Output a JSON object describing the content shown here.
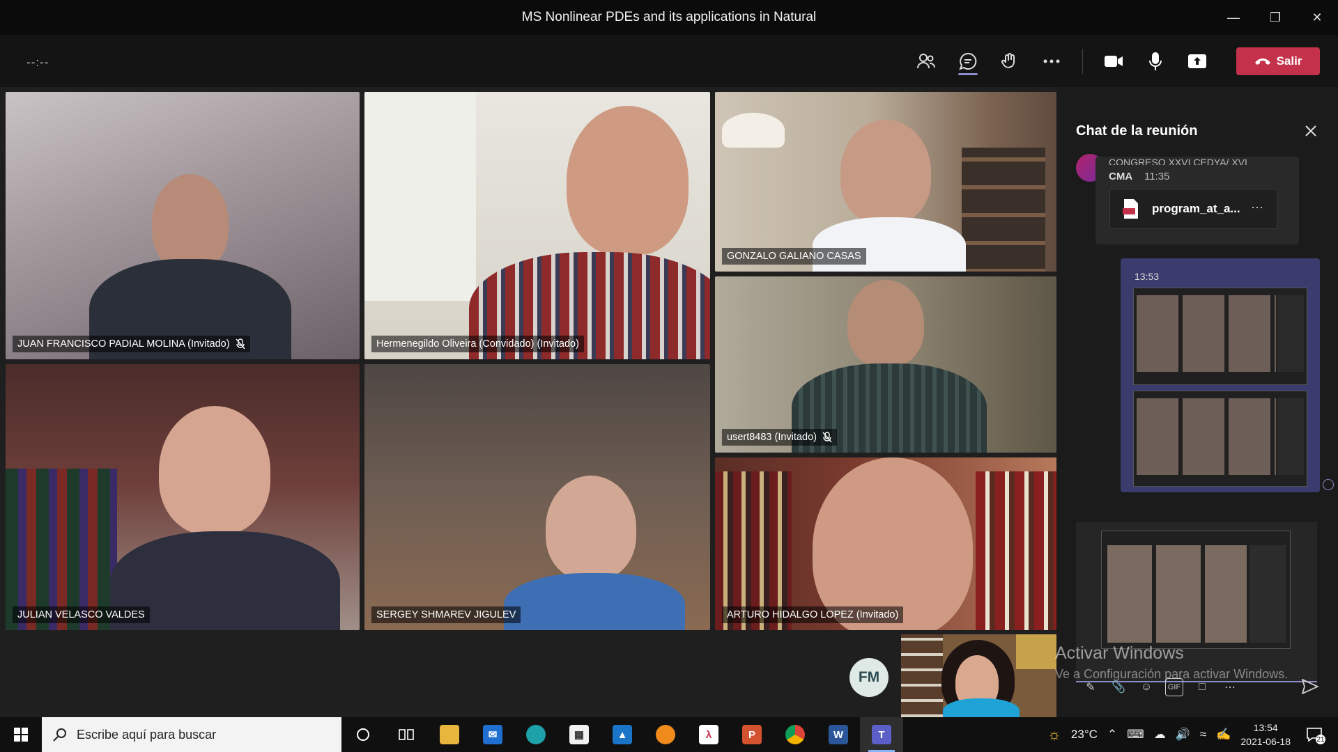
{
  "window": {
    "title": "MS Nonlinear PDEs and its applications in Natural"
  },
  "toolbar": {
    "timer": "--:--",
    "leave_label": "Salir"
  },
  "participants": [
    {
      "name": "JUAN FRANCISCO PADIAL MOLINA (Invitado)",
      "muted": true
    },
    {
      "name": "Hermenegildo Oliveira (Convidado) (Invitado)",
      "muted": false
    },
    {
      "name": "GONZALO GALIANO CASAS",
      "muted": false
    },
    {
      "name": "usert8483 (Invitado)",
      "muted": true
    },
    {
      "name": "JULIAN VELASCO VALDES",
      "muted": false
    },
    {
      "name": "SERGEY SHMAREV JIGULEV",
      "muted": false
    },
    {
      "name": "ARTURO HIDALGO LOPEZ (Invitado)",
      "muted": false
    }
  ],
  "self_avatar_initials": "FM",
  "chat": {
    "title": "Chat de la reunión",
    "message1": {
      "clipped_text": "CONGRESO XXVI CEDYA/ XVI",
      "sender": "CMA",
      "time": "11:35",
      "file_name": "program_at_a..."
    },
    "message2": {
      "time": "13:53"
    }
  },
  "watermark": {
    "line1": "Activar Windows",
    "line2": "Ve a Configuración para activar Windows."
  },
  "taskbar": {
    "search_placeholder": "Escribe aquí para buscar",
    "weather": "23°C",
    "time": "13:54",
    "date": "2021-06-18",
    "notifications": "21"
  },
  "colors": {
    "accent": "#8b8cc7",
    "leave": "#c4314b",
    "chat_bubble_self": "#3b3c6e"
  }
}
